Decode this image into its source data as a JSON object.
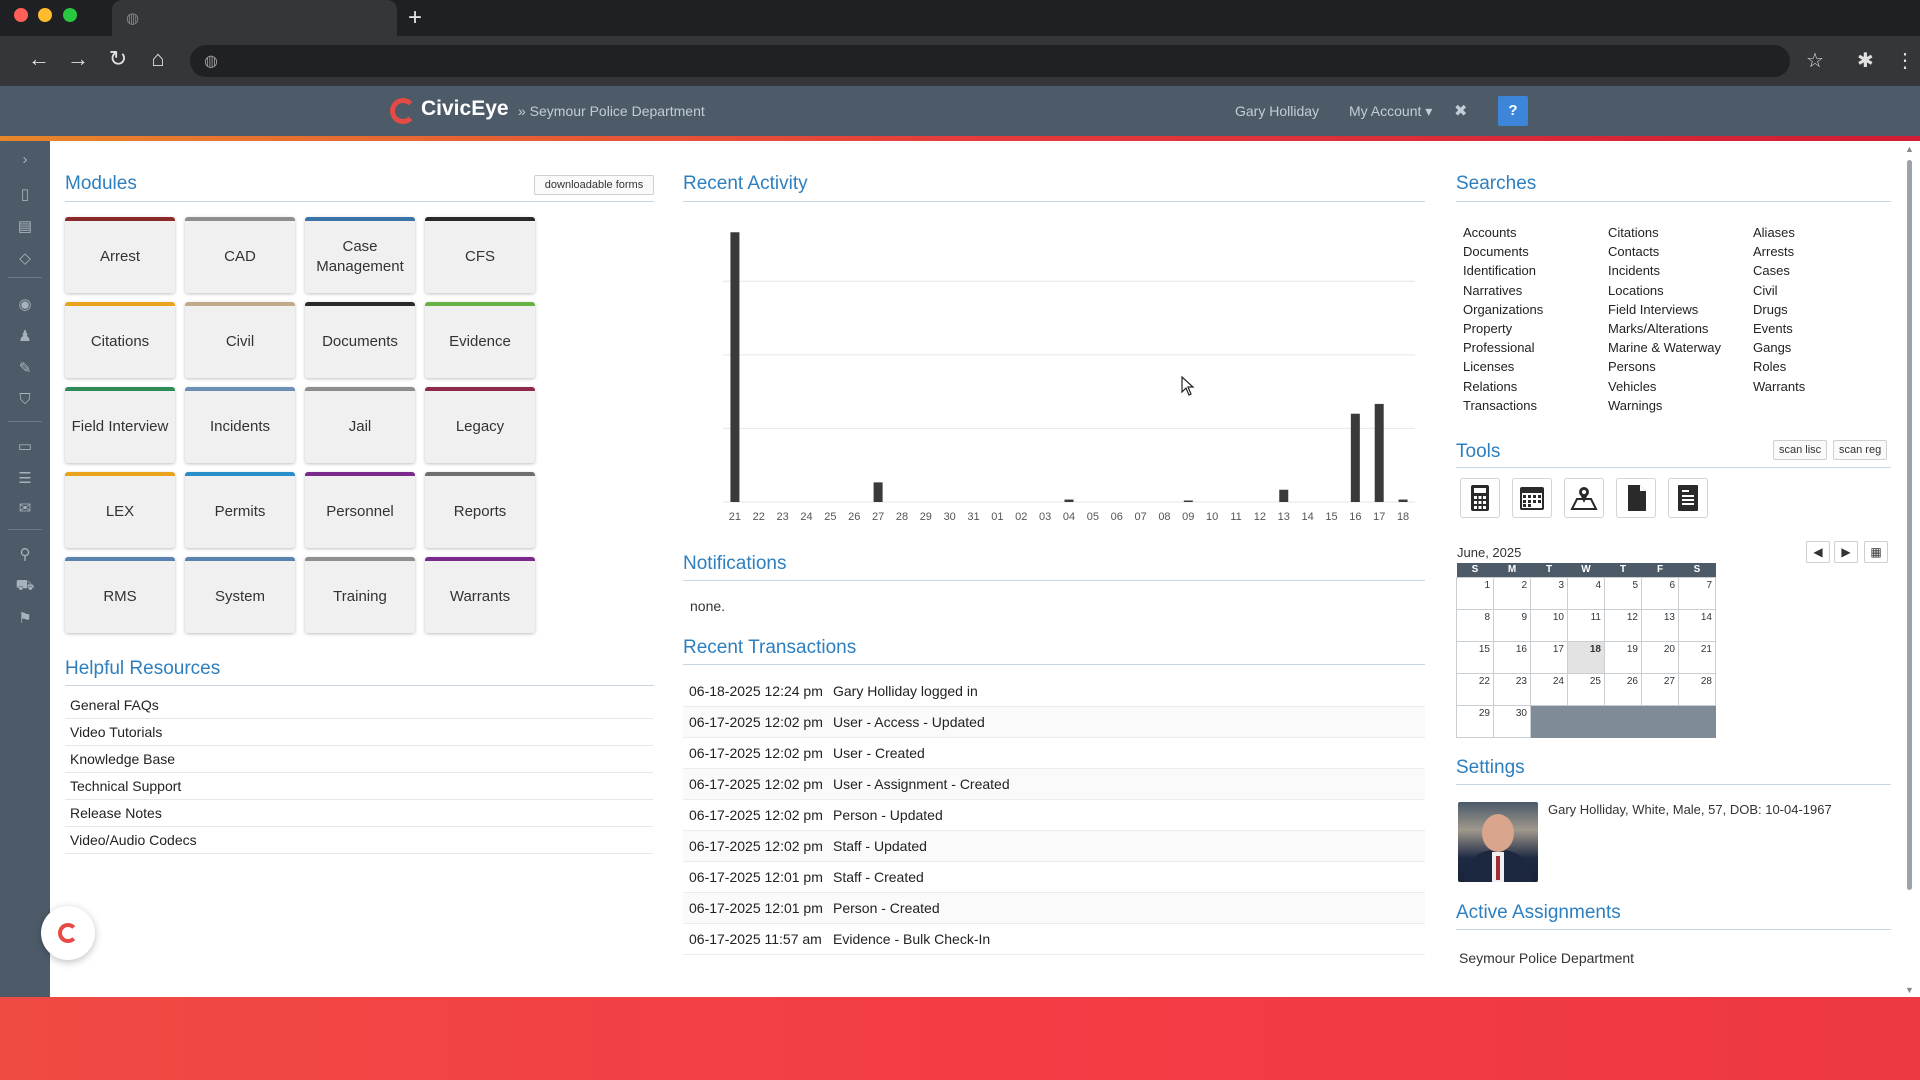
{
  "colors": {
    "accent": "#2e7fbf",
    "header_bg": "#4d5b69",
    "brand_red": "#e64a45"
  },
  "browser": {
    "tab_icon": "globe-icon",
    "new_tab": "+"
  },
  "header": {
    "logo": "CivicEye",
    "breadcrumb": "» Seymour Police Department",
    "user": "Gary Holliday",
    "account": "My Account ▾",
    "close": "✖",
    "help": "?"
  },
  "modules": {
    "title": "Modules",
    "downloadable_forms": "downloadable forms",
    "tiles": [
      {
        "label": "Arrest",
        "color": "#8b2a2a"
      },
      {
        "label": "CAD",
        "color": "#8e8e8e"
      },
      {
        "label": "Case Management",
        "color": "#3a73a8"
      },
      {
        "label": "CFS",
        "color": "#2a2a2a"
      },
      {
        "label": "Citations",
        "color": "#e9a31c"
      },
      {
        "label": "Civil",
        "color": "#c2a98a"
      },
      {
        "label": "Documents",
        "color": "#2a2a2a"
      },
      {
        "label": "Evidence",
        "color": "#66b344"
      },
      {
        "label": "Field Interview",
        "color": "#2e8b57"
      },
      {
        "label": "Incidents",
        "color": "#6b8fb5"
      },
      {
        "label": "Jail",
        "color": "#8e8e8e"
      },
      {
        "label": "Legacy",
        "color": "#8b2a4a"
      },
      {
        "label": "LEX",
        "color": "#e9a31c"
      },
      {
        "label": "Permits",
        "color": "#2a8fc9"
      },
      {
        "label": "Personnel",
        "color": "#7b2a8b"
      },
      {
        "label": "Reports",
        "color": "#6e6e6e"
      },
      {
        "label": "RMS",
        "color": "#5a82b0"
      },
      {
        "label": "System",
        "color": "#5a82b0"
      },
      {
        "label": "Training",
        "color": "#8e8e8e"
      },
      {
        "label": "Warrants",
        "color": "#7b2a8b"
      }
    ]
  },
  "resources": {
    "title": "Helpful Resources",
    "items": [
      "General FAQs",
      "Video Tutorials",
      "Knowledge Base",
      "Technical Support",
      "Release Notes",
      "Video/Audio Codecs"
    ]
  },
  "recent_activity": {
    "title": "Recent Activity"
  },
  "chart_data": {
    "type": "bar",
    "title": "",
    "categories": [
      "21",
      "22",
      "23",
      "24",
      "25",
      "26",
      "27",
      "28",
      "29",
      "30",
      "31",
      "01",
      "02",
      "03",
      "04",
      "05",
      "06",
      "07",
      "08",
      "09",
      "10",
      "11",
      "12",
      "13",
      "14",
      "15",
      "16",
      "17",
      "18"
    ],
    "values": [
      110,
      0,
      0,
      0,
      0,
      0,
      8,
      0,
      0,
      0,
      0,
      0,
      0,
      0,
      1,
      0,
      0,
      0,
      0,
      0.5,
      0,
      0,
      0,
      5,
      0,
      0,
      36,
      40,
      1
    ],
    "ylim": [
      0,
      115
    ],
    "grid": true
  },
  "notifications": {
    "title": "Notifications",
    "text": "none."
  },
  "transactions": {
    "title": "Recent Transactions",
    "rows": [
      {
        "date": "06-18-2025 12:24 pm",
        "desc": "Gary Holliday logged in"
      },
      {
        "date": "06-17-2025 12:02 pm",
        "desc": "User - Access - Updated"
      },
      {
        "date": "06-17-2025 12:02 pm",
        "desc": "User - Created"
      },
      {
        "date": "06-17-2025 12:02 pm",
        "desc": "User - Assignment - Created"
      },
      {
        "date": "06-17-2025 12:02 pm",
        "desc": "Person - Updated"
      },
      {
        "date": "06-17-2025 12:02 pm",
        "desc": "Staff - Updated"
      },
      {
        "date": "06-17-2025 12:01 pm",
        "desc": "Staff - Created"
      },
      {
        "date": "06-17-2025 12:01 pm",
        "desc": "Person - Created"
      },
      {
        "date": "06-17-2025 11:57 am",
        "desc": "Evidence - Bulk Check-In"
      }
    ]
  },
  "searches": {
    "title": "Searches",
    "columns": [
      [
        "Accounts",
        "Documents",
        "Identification",
        "Narratives",
        "Organizations",
        "Property",
        "Professional",
        "Licenses",
        "Relations",
        "Transactions"
      ],
      [
        "Citations",
        "Contacts",
        "Incidents",
        "Locations",
        "Field Interviews",
        "Marks/Alterations",
        "Marine & Waterway",
        "Persons",
        "Vehicles",
        "Warnings"
      ],
      [
        "Aliases",
        "Arrests",
        "Cases",
        "Civil",
        "Drugs",
        "Events",
        "Gangs",
        "Roles",
        "Warrants"
      ]
    ]
  },
  "tools": {
    "title": "Tools",
    "scan_lisc": "scan lisc",
    "scan_reg": "scan reg",
    "icons": [
      "calculator-icon",
      "calendar-icon",
      "map-icon",
      "document-icon",
      "report-icon"
    ]
  },
  "calendar": {
    "month": "June, 2025",
    "weekdays": [
      "S",
      "M",
      "T",
      "W",
      "T",
      "F",
      "S"
    ],
    "weeks": [
      [
        "1",
        "2",
        "3",
        "4",
        "5",
        "6",
        "7"
      ],
      [
        "8",
        "9",
        "10",
        "11",
        "12",
        "13",
        "14"
      ],
      [
        "15",
        "16",
        "17",
        "18",
        "19",
        "20",
        "21"
      ],
      [
        "22",
        "23",
        "24",
        "25",
        "26",
        "27",
        "28"
      ],
      [
        "29",
        "30",
        "",
        "",
        "",
        "",
        ""
      ]
    ],
    "today": "18"
  },
  "settings": {
    "title": "Settings",
    "profile": "Gary Holliday, White, Male, 57, DOB: 10-04-1967"
  },
  "assignments": {
    "title": "Active Assignments",
    "item": "Seymour Police Department"
  }
}
